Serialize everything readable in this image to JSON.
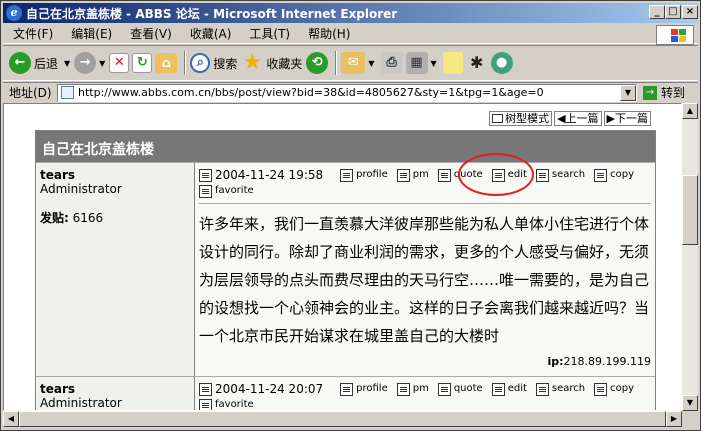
{
  "window": {
    "title": "自己在北京盖栋楼 - ABBS 论坛 - Microsoft Internet Explorer",
    "min": "_",
    "max": "□",
    "close": "×"
  },
  "menu": [
    "文件(F)",
    "编辑(E)",
    "查看(V)",
    "收藏(A)",
    "工具(T)",
    "帮助(H)"
  ],
  "toolbar": {
    "back": "后退",
    "search": "搜索",
    "favorites": "收藏夹"
  },
  "address": {
    "label": "地址(D)",
    "url": "http://www.abbs.com.cn/bbs/post/view?bid=38&id=4805627&sty=1&tpg=1&age=0",
    "go": "转到"
  },
  "nav": {
    "tree": "树型模式",
    "prev": "上一篇",
    "next": "下一篇"
  },
  "thread": {
    "title": "自己在北京盖栋楼"
  },
  "posts": [
    {
      "author": "tears",
      "role": "Administrator",
      "posts_label": "发贴:",
      "posts_count": "6166",
      "date": "2004-11-24 19:58",
      "actions": [
        "profile",
        "pm",
        "quote",
        "edit",
        "search",
        "copy",
        "favorite"
      ],
      "content": "许多年来，我们一直羡慕大洋彼岸那些能为私人单体小住宅进行个体设计的同行。除却了商业利润的需求，更多的个人感受与偏好，无须为层层领导的点头而费尽理由的天马行空……唯一需要的，是为自己的设想找一个心领神会的业主。这样的日子会离我们越来越近吗？当一个北京市民开始谋求在城里盖自己的大楼时",
      "ip_label": "ip:",
      "ip": "218.89.199.119"
    },
    {
      "author": "tears",
      "role": "Administrator",
      "date": "2004-11-24 20:07",
      "actions": [
        "profile",
        "pm",
        "quote",
        "edit",
        "search",
        "copy",
        "favorite"
      ]
    }
  ]
}
